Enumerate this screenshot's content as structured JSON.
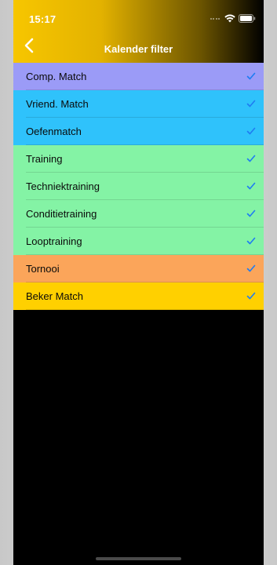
{
  "status_bar": {
    "time": "15:17",
    "icons": [
      "cellular-dots-icon",
      "wifi-icon",
      "battery-icon"
    ]
  },
  "nav": {
    "back_icon": "chevron-left-icon",
    "title": "Kalender filter"
  },
  "colors": {
    "header_gradient": [
      "#f7c600",
      "#000000"
    ],
    "check": "#1e7cf2",
    "background": "#000000"
  },
  "filters": [
    {
      "label": "Comp. Match",
      "color": "#9b9bf7",
      "checked": true
    },
    {
      "label": "Vriend. Match",
      "color": "#2fc2fb",
      "checked": true
    },
    {
      "label": "Oefenmatch",
      "color": "#2fc2fb",
      "checked": true
    },
    {
      "label": "Training",
      "color": "#84f3a5",
      "checked": true
    },
    {
      "label": "Techniektraining",
      "color": "#84f3a5",
      "checked": true
    },
    {
      "label": "Conditietraining",
      "color": "#84f3a5",
      "checked": true
    },
    {
      "label": "Looptraining",
      "color": "#84f3a5",
      "checked": true
    },
    {
      "label": "Tornooi",
      "color": "#fba55a",
      "checked": true
    },
    {
      "label": "Beker Match",
      "color": "#ffd000",
      "checked": true
    }
  ]
}
